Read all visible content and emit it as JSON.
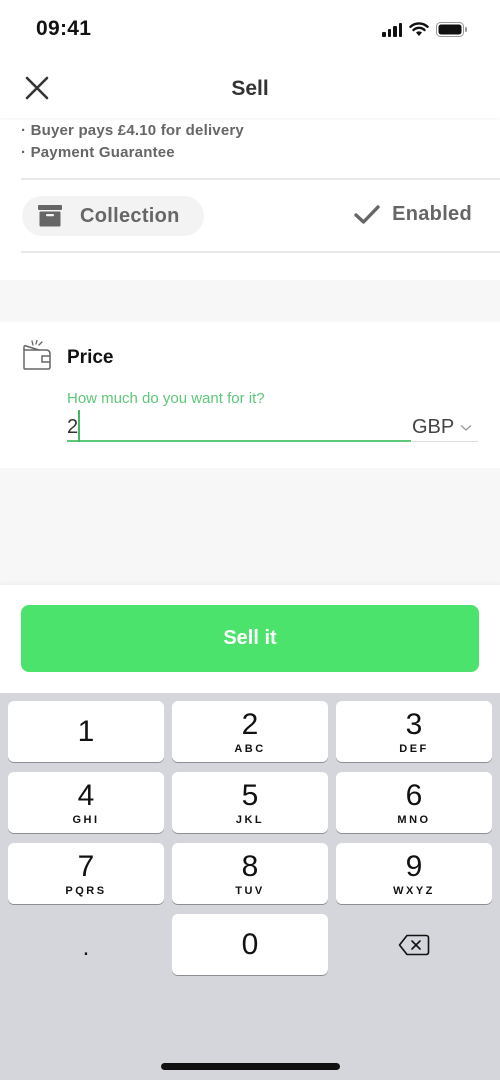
{
  "status_bar": {
    "time": "09:41"
  },
  "nav": {
    "title": "Sell",
    "close_icon": "close-icon"
  },
  "delivery": {
    "bullets": [
      "· Buyer pays £4.10 for delivery",
      "· Payment Guarantee"
    ],
    "collection": {
      "label": "Collection",
      "icon": "box-icon"
    },
    "status": {
      "label": "Enabled",
      "icon": "checkmark-icon"
    }
  },
  "price": {
    "title": "Price",
    "icon": "wallet-icon",
    "field_label": "How much do you want for it?",
    "value": "2",
    "currency": "GBP"
  },
  "actions": {
    "sell_label": "Sell it"
  },
  "colors": {
    "accent": "#4be36c",
    "field_accent": "#5dc77a"
  },
  "keyboard": {
    "keys": [
      {
        "num": "1",
        "letters": ""
      },
      {
        "num": "2",
        "letters": "ABC"
      },
      {
        "num": "3",
        "letters": "DEF"
      },
      {
        "num": "4",
        "letters": "GHI"
      },
      {
        "num": "5",
        "letters": "JKL"
      },
      {
        "num": "6",
        "letters": "MNO"
      },
      {
        "num": "7",
        "letters": "PQRS"
      },
      {
        "num": "8",
        "letters": "TUV"
      },
      {
        "num": "9",
        "letters": "WXYZ"
      },
      {
        "num": "0",
        "letters": ""
      }
    ],
    "decimal": ".",
    "delete_icon": "backspace-icon"
  }
}
